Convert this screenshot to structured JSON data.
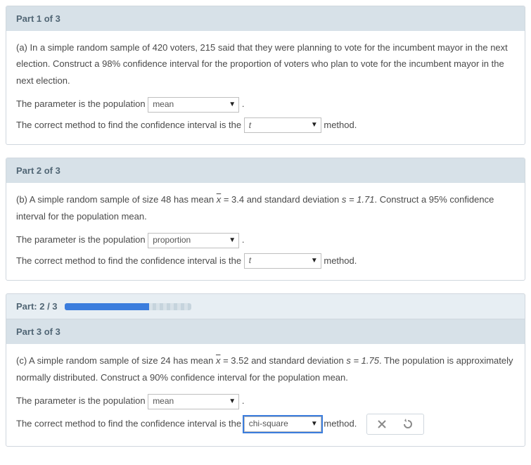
{
  "part1": {
    "header": "Part 1 of 3",
    "prompt": "(a) In a simple random sample of 420 voters, 215 said that they were planning to vote for the incumbent mayor in the next election. Construct a 98% confidence interval for the proportion of voters who plan to vote for the incumbent mayor in the next election.",
    "line_param_before": "The parameter is the population",
    "select_param": "mean",
    "line_method_before": "The correct method to find the confidence interval is the",
    "select_method": "t",
    "line_method_after": "method."
  },
  "part2": {
    "header": "Part 2 of 3",
    "prompt_before": "(b) A simple random sample of size 48 has mean ",
    "prompt_mid1": " = 3.4 and standard deviation ",
    "s_eq": "s = 1.71",
    "prompt_after": ". Construct a 95% confidence interval for the population mean.",
    "line_param_before": "The parameter is the population",
    "select_param": "proportion",
    "line_method_before": "The correct method to find the confidence interval is the",
    "select_method": "t",
    "line_method_after": "method."
  },
  "progress": {
    "label": "Part: 2 / 3",
    "percent": 67
  },
  "part3": {
    "header": "Part 3 of 3",
    "prompt_before": "(c) A simple random sample of size 24 has mean ",
    "prompt_mid1": " = 3.52 and standard deviation ",
    "s_eq": "s = 1.75",
    "prompt_after": ". The population is approximately normally distributed. Construct a 90% confidence interval for the population mean.",
    "line_param_before": "The parameter is the population",
    "select_param": "mean",
    "line_method_before": "The correct method to find the confidence interval is the",
    "select_method": "chi-square",
    "line_method_after": "method."
  },
  "xbar_symbol": "x"
}
